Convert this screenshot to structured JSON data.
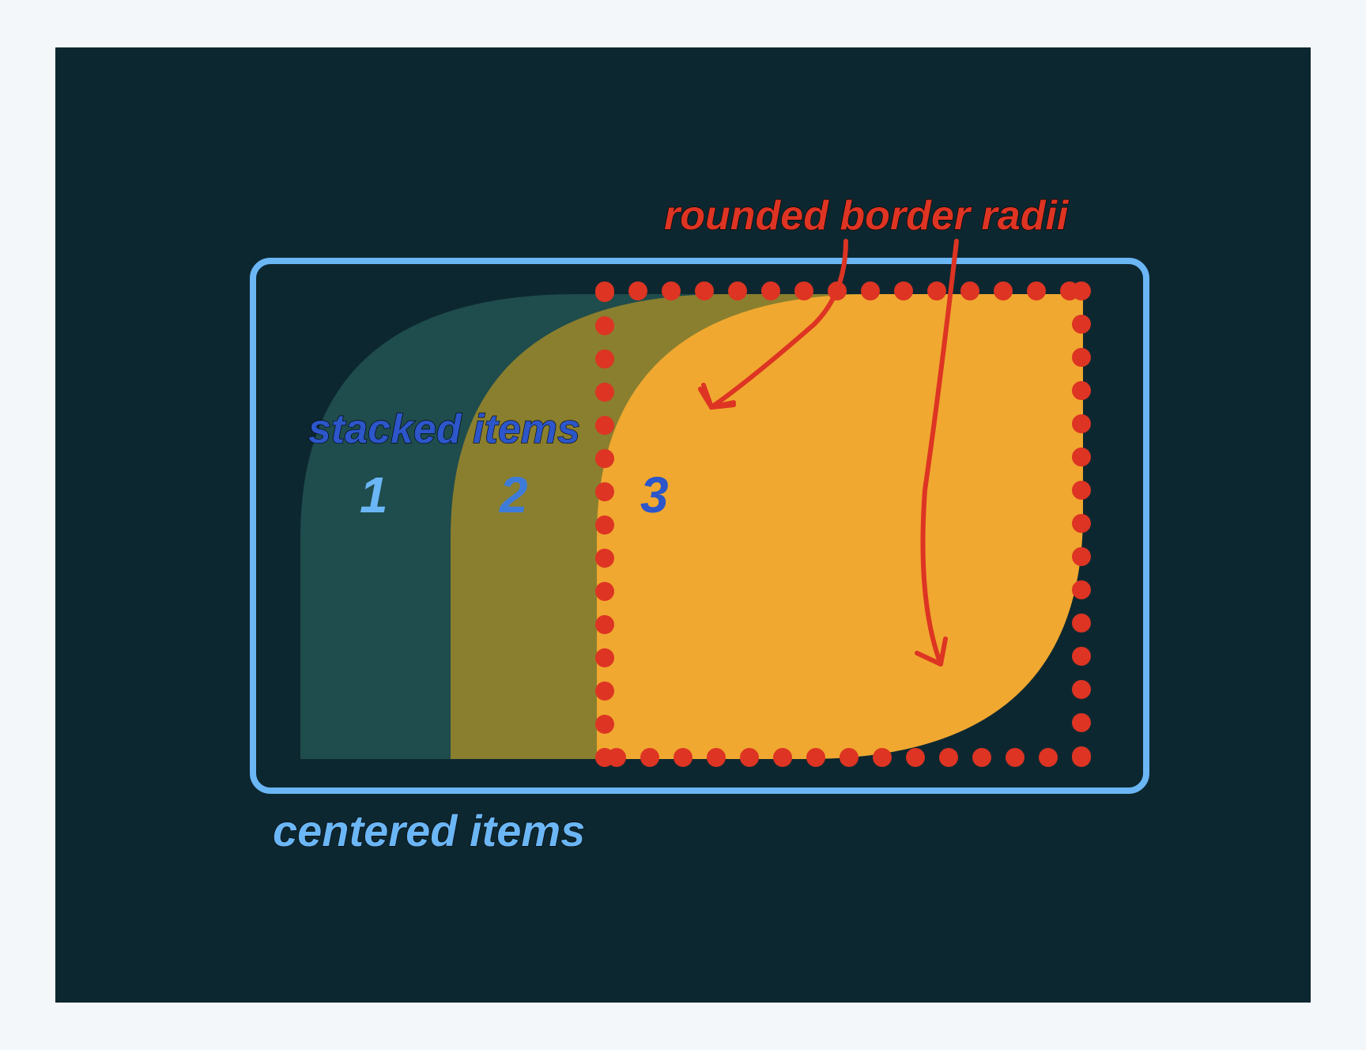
{
  "labels": {
    "rounded": "rounded border radii",
    "stacked": "stacked items",
    "centered": "centered items"
  },
  "items": {
    "one": "1",
    "two": "2",
    "three": "3"
  },
  "colors": {
    "bg": "#0d2730",
    "item1": "#1f4c4c",
    "item2": "#8a7f2f",
    "item3": "#f0a830",
    "outline": "#6bb6f5",
    "red": "#dd3423"
  }
}
